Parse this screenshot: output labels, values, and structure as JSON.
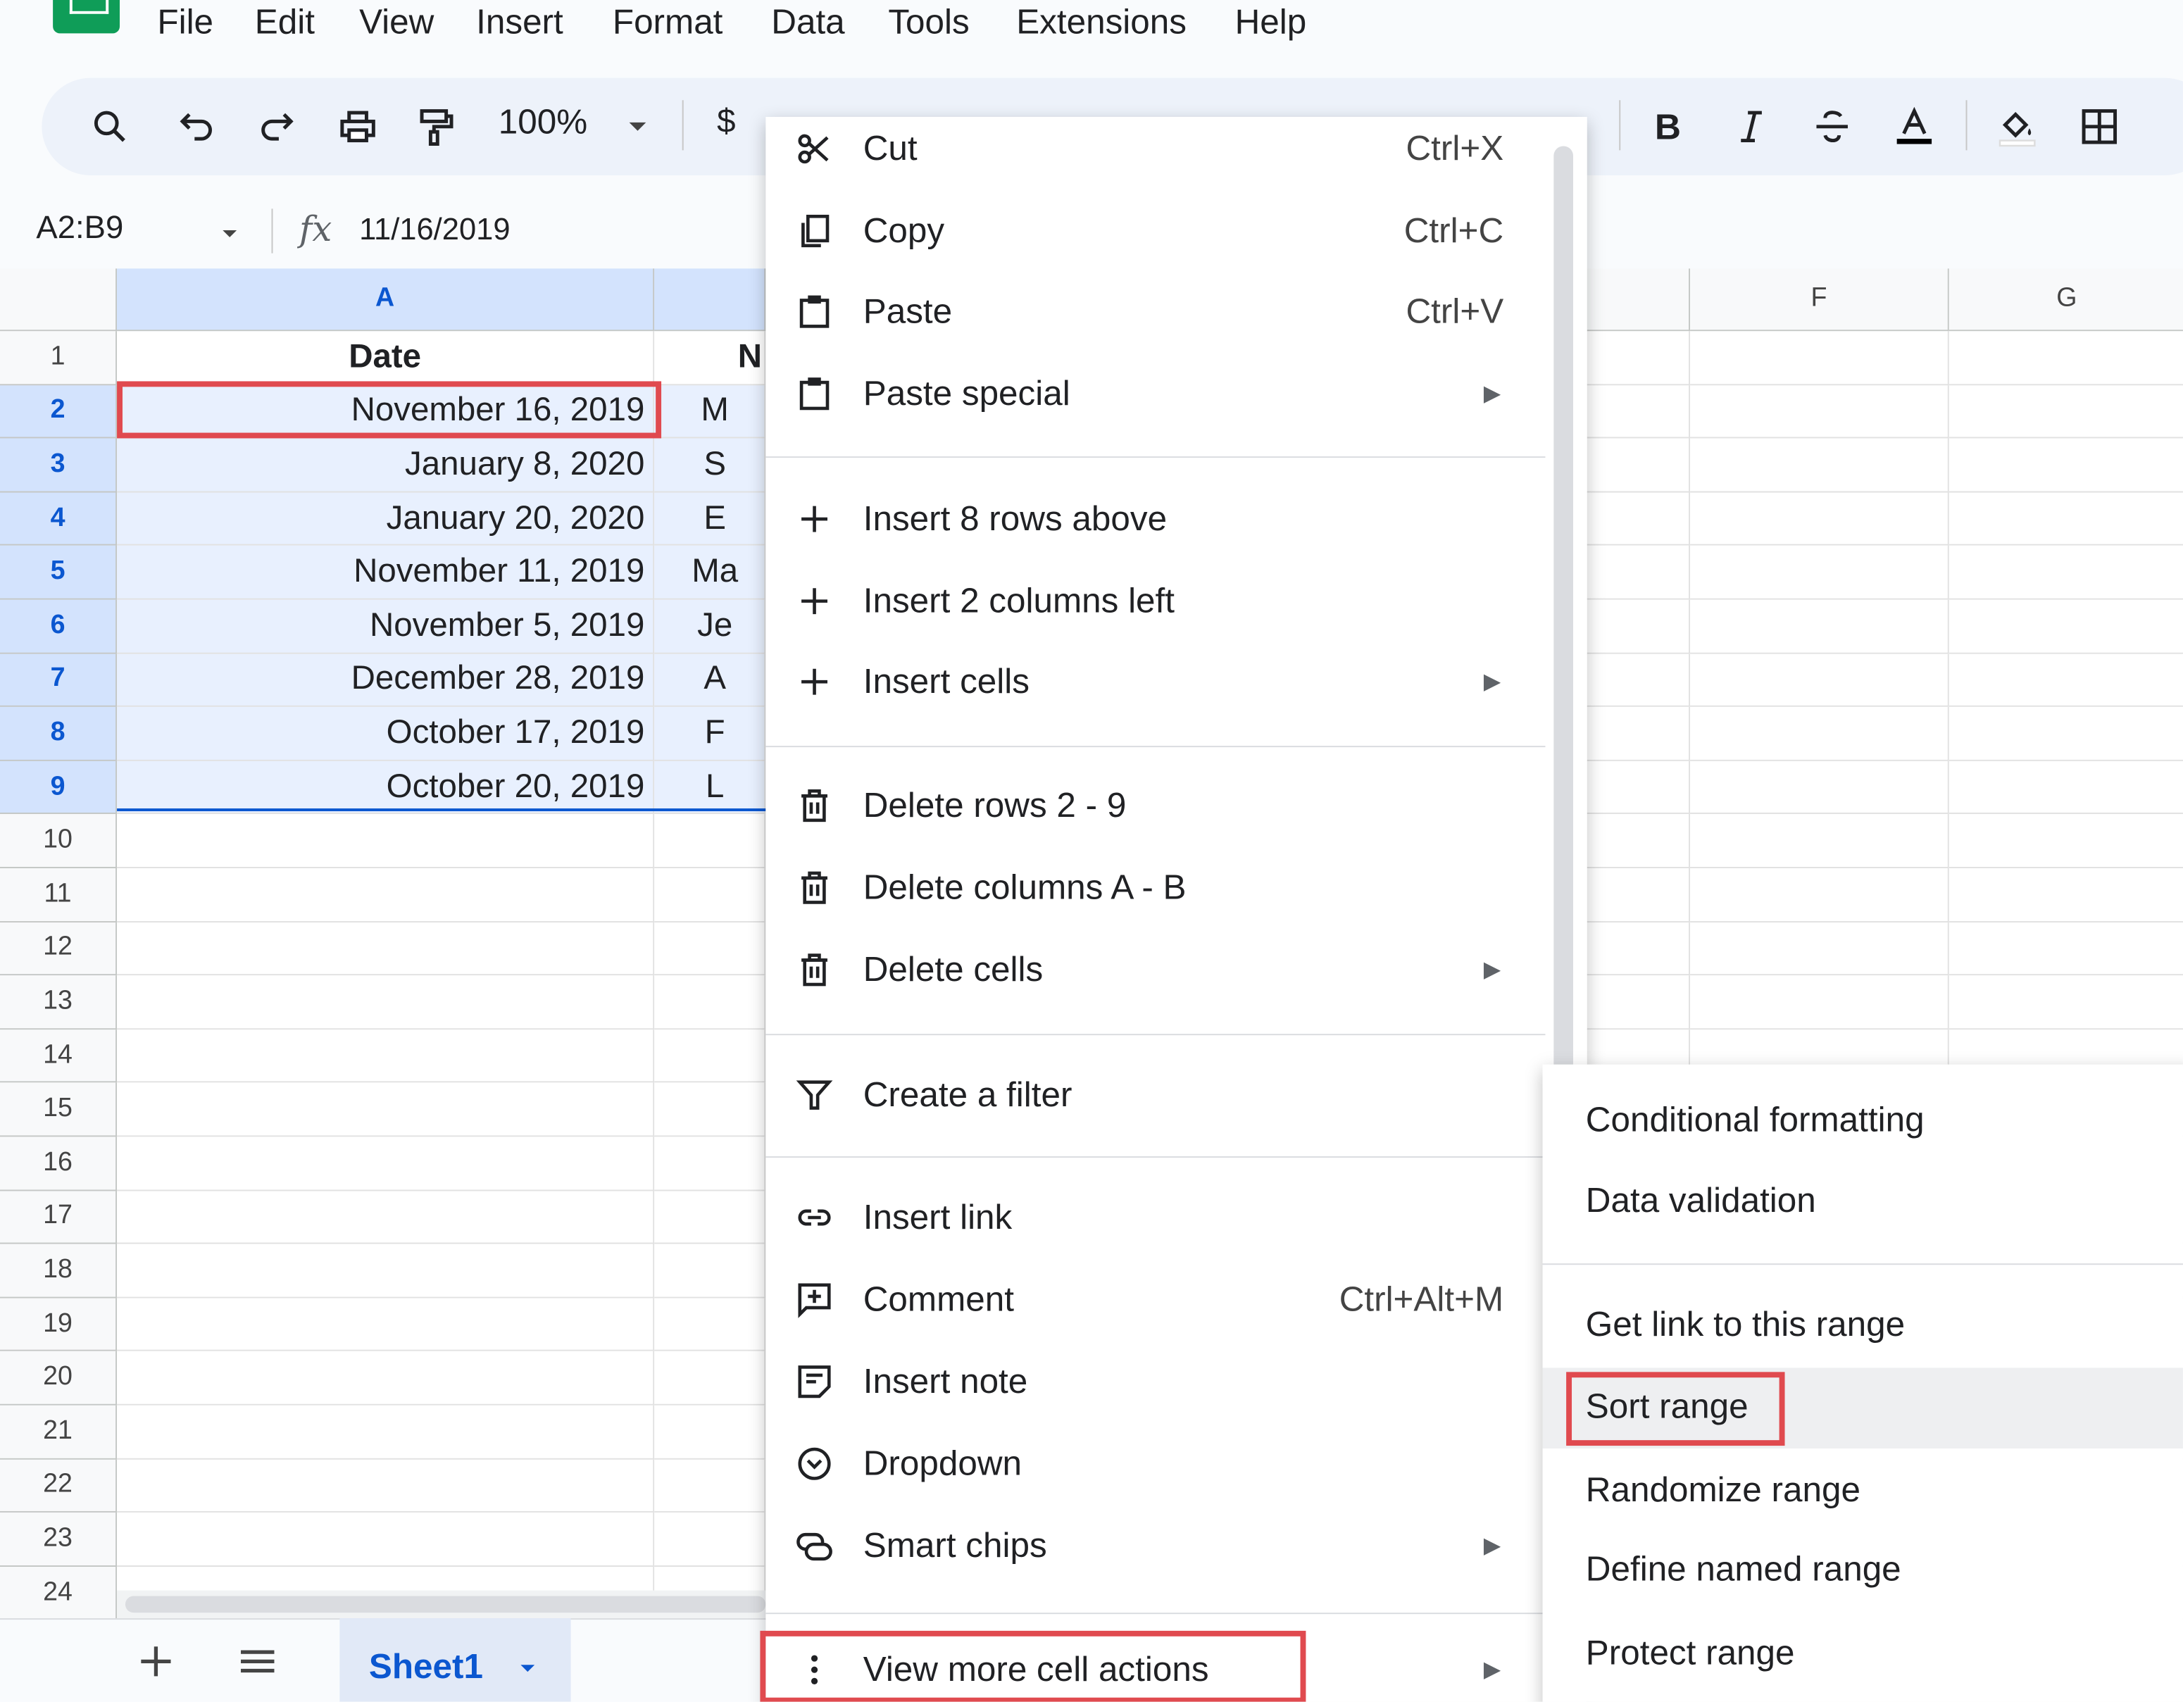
{
  "menubar": {
    "items": [
      "File",
      "Edit",
      "View",
      "Insert",
      "Format",
      "Data",
      "Tools",
      "Extensions",
      "Help"
    ]
  },
  "toolbar": {
    "zoom": "100%",
    "currency": "$",
    "icons": [
      "search-icon",
      "undo-icon",
      "redo-icon",
      "print-icon",
      "paint-format-icon",
      "bold-icon",
      "italic-icon",
      "strikethrough-icon",
      "text-color-icon",
      "fill-color-icon",
      "borders-icon"
    ]
  },
  "formula_bar": {
    "name_box": "A2:B9",
    "fx": "fx",
    "value": "11/16/2019"
  },
  "grid": {
    "columns": [
      "A",
      "F",
      "G"
    ],
    "rows": [
      "1",
      "2",
      "3",
      "4",
      "5",
      "6",
      "7",
      "8",
      "9",
      "10",
      "11",
      "12",
      "13",
      "14",
      "15",
      "16",
      "17",
      "18",
      "19",
      "20",
      "21",
      "22",
      "23",
      "24"
    ],
    "header_a": "Date",
    "header_b": "N",
    "col_a": [
      "November 16, 2019",
      "January 8, 2020",
      "January 20, 2020",
      "November 11, 2019",
      "November 5, 2019",
      "December 28, 2019",
      "October 17, 2019",
      "October 20, 2019"
    ],
    "col_b": [
      "M",
      "S",
      "E",
      "Ma",
      "Je",
      "A",
      "F",
      "L"
    ]
  },
  "context_menu": {
    "items": [
      {
        "label": "Cut",
        "shortcut": "Ctrl+X",
        "icon": "cut-icon"
      },
      {
        "label": "Copy",
        "shortcut": "Ctrl+C",
        "icon": "copy-icon"
      },
      {
        "label": "Paste",
        "shortcut": "Ctrl+V",
        "icon": "paste-icon"
      },
      {
        "label": "Paste special",
        "icon": "paste-icon"
      },
      {
        "label": "Insert 8 rows above",
        "icon": "plus-icon"
      },
      {
        "label": "Insert 2 columns left",
        "icon": "plus-icon"
      },
      {
        "label": "Insert cells",
        "icon": "plus-icon"
      },
      {
        "label": "Delete rows 2 - 9",
        "icon": "trash-icon"
      },
      {
        "label": "Delete columns A - B",
        "icon": "trash-icon"
      },
      {
        "label": "Delete cells",
        "icon": "trash-icon"
      },
      {
        "label": "Create a filter",
        "icon": "filter-icon"
      },
      {
        "label": "Insert link",
        "icon": "link-icon"
      },
      {
        "label": "Comment",
        "shortcut": "Ctrl+Alt+M",
        "icon": "comment-icon"
      },
      {
        "label": "Insert note",
        "icon": "note-icon"
      },
      {
        "label": "Dropdown",
        "icon": "dropdown-icon"
      },
      {
        "label": "Smart chips",
        "icon": "smart-chips-icon"
      },
      {
        "label": "View more cell actions",
        "icon": "more-vert-icon"
      }
    ]
  },
  "submenu": {
    "items": [
      "Conditional formatting",
      "Data validation",
      "Get link to this range",
      "Sort range",
      "Randomize range",
      "Define named range",
      "Protect range"
    ]
  },
  "sheet_tabs": {
    "active": "Sheet1"
  },
  "colors": {
    "highlight": "#e04a4f",
    "selection": "#e8f0fe",
    "accent": "#0b57d0"
  }
}
